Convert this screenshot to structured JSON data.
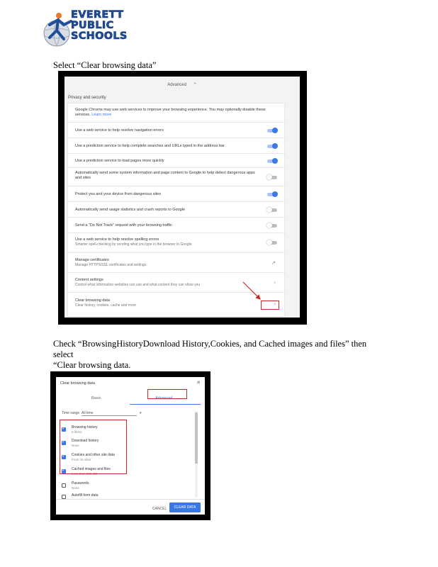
{
  "logo": {
    "lines": [
      "EVERETT",
      "PUBLIC",
      "SCHOOLS"
    ],
    "colors": {
      "brand_blue": "#1f4e9a",
      "accent_orange": "#e8762b"
    }
  },
  "step1": {
    "instruction": "Select “Clear browsing data”",
    "advanced_label": "Advanced",
    "section_title": "Privacy and security",
    "rows": [
      {
        "title": "Google Chrome may use web services to improve your browsing experience. You may optionally disable these services.",
        "link": "Learn more"
      },
      {
        "title": "Use a web service to help resolve navigation errors",
        "toggle": "on"
      },
      {
        "title": "Use a prediction service to help complete searches and URLs typed in the address bar",
        "toggle": "on"
      },
      {
        "title": "Use a prediction service to load pages more quickly",
        "toggle": "on"
      },
      {
        "title": "Automatically send some system information and page content to Google to help detect dangerous apps and sites",
        "toggle": "off"
      },
      {
        "title": "Protect you and your device from dangerous sites",
        "toggle": "on"
      },
      {
        "title": "Automatically send usage statistics and crash reports to Google",
        "toggle": "off"
      },
      {
        "title": "Send a \"Do Not Track\" request with your browsing traffic",
        "toggle": "off"
      },
      {
        "title": "Use a web service to help resolve spelling errors",
        "subtitle": "Smarter spell-checking by sending what you type in the browser to Google",
        "toggle": "off"
      },
      {
        "title": "Manage certificates",
        "subtitle": "Manage HTTPS/SSL certificates and settings",
        "icon": "external-link-icon"
      },
      {
        "title": "Content settings",
        "subtitle": "Control what information websites can use and what content they can show you",
        "icon": "chevron-right-icon"
      },
      {
        "title": "Clear browsing data",
        "subtitle": "Clear history, cookies, cache and more",
        "icon": "chevron-right-icon"
      }
    ]
  },
  "step2": {
    "instruction_line1": "Check “BrowsingHistoryDownload History,Cookies, and Cached images and files” then select",
    "instruction_line2": "“Clear browsing data.",
    "dialog_title": "Clear browsing data",
    "tabs": [
      "Basic",
      "Advanced"
    ],
    "time_range_label": "Time range",
    "time_range_value": "All time",
    "items": [
      {
        "title": "Browsing history",
        "subtitle": "8 items",
        "checked": true
      },
      {
        "title": "Download history",
        "subtitle": "None",
        "checked": true
      },
      {
        "title": "Cookies and other site data",
        "subtitle": "From 16 sites",
        "checked": true
      },
      {
        "title": "Cached images and files",
        "subtitle": "Less than 335 MB",
        "checked": true
      },
      {
        "title": "Passwords",
        "subtitle": "None",
        "checked": false
      },
      {
        "title": "Autofill form data",
        "subtitle": "",
        "checked": false
      }
    ],
    "cancel_label": "CANCEL",
    "clear_label": "CLEAR DATA"
  },
  "colors": {
    "highlight_red": "#c62828",
    "chrome_blue": "#3b78e7"
  }
}
